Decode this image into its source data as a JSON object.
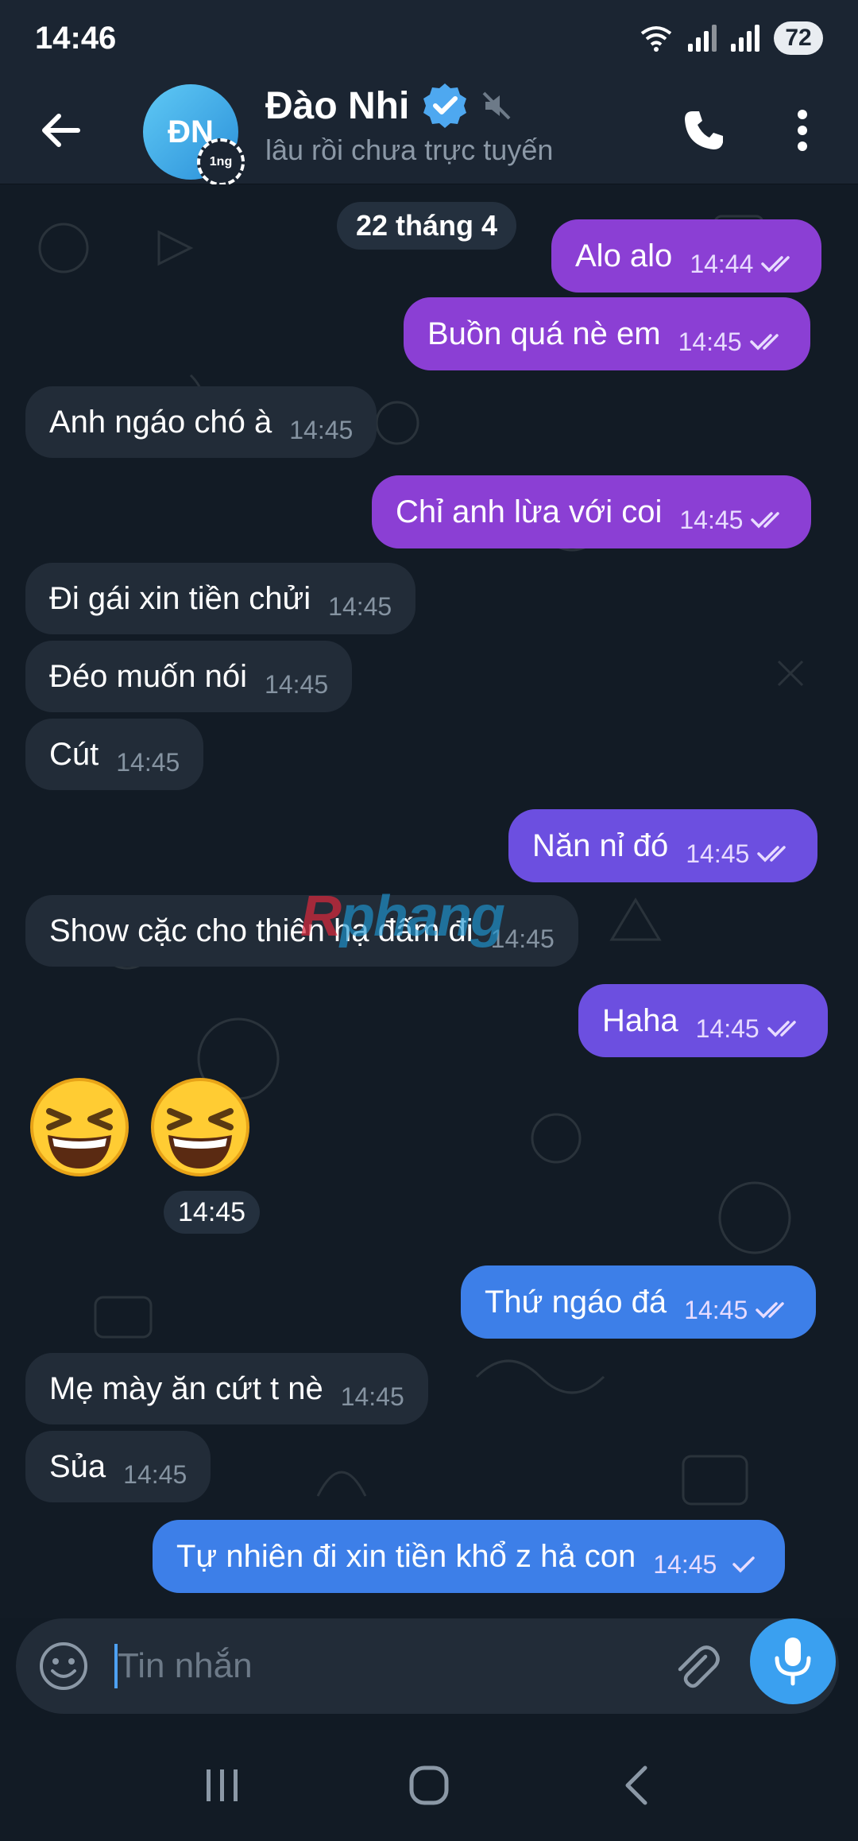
{
  "status_bar": {
    "time": "14:46",
    "battery": "72",
    "network": "5"
  },
  "header": {
    "contact_name": "Đào Nhi",
    "avatar_initials": "ĐN",
    "story_badge": "1ng",
    "last_seen": "lâu rồi chưa trực tuyến",
    "verified": true,
    "muted": true
  },
  "chat": {
    "date_separator": "22 tháng 4",
    "messages": [
      {
        "direction": "out",
        "text": "Alo alo",
        "time": "14:44",
        "status": "read"
      },
      {
        "direction": "out",
        "text": "Buồn quá nè em",
        "time": "14:45",
        "status": "read"
      },
      {
        "direction": "in",
        "text": "Anh ngáo chó à",
        "time": "14:45"
      },
      {
        "direction": "out",
        "text": "Chỉ anh lừa với coi",
        "time": "14:45",
        "status": "read"
      },
      {
        "direction": "in",
        "text": "Đi gái xin tiền chửi",
        "time": "14:45"
      },
      {
        "direction": "in",
        "text": "Đéo muốn nói",
        "time": "14:45"
      },
      {
        "direction": "in",
        "text": "Cút",
        "time": "14:45"
      },
      {
        "direction": "out",
        "text": "Năn nỉ đó",
        "time": "14:45",
        "status": "read"
      },
      {
        "direction": "in",
        "text": "Show cặc cho thiên hạ đấm đi",
        "time": "14:45"
      },
      {
        "direction": "out",
        "text": "Haha",
        "time": "14:45",
        "status": "read"
      },
      {
        "direction": "in",
        "type": "emoji",
        "emoji": [
          "grinning-squinting-face",
          "grinning-squinting-face"
        ],
        "time": "14:45"
      },
      {
        "direction": "out",
        "text": "Thứ ngáo đá",
        "time": "14:45",
        "status": "read"
      },
      {
        "direction": "in",
        "text": "Mẹ mày ăn cứt t nè",
        "time": "14:45"
      },
      {
        "direction": "in",
        "text": "Sủa",
        "time": "14:45"
      },
      {
        "direction": "out",
        "text": "Tự nhiên đi xin tiền khổ z hả con",
        "time": "14:45",
        "status": "sent"
      }
    ],
    "watermark": {
      "prefix": "R",
      "rest": "phang"
    }
  },
  "composer": {
    "placeholder": "Tin nhắn",
    "value": ""
  },
  "colors": {
    "header_bg": "#1b2532",
    "chat_bg": "#121b25",
    "incoming_bubble": "#222c38",
    "outgoing_purple": "#8b3fd4",
    "outgoing_indigo": "#6c4fe0",
    "outgoing_blue": "#3d7fe8",
    "accent": "#3aa0f0"
  },
  "icons": {
    "back": "arrow-left-icon",
    "verified": "verified-badge-icon",
    "muted": "speaker-muted-icon",
    "call": "phone-icon",
    "more": "more-vertical-icon",
    "emoji": "smiley-icon",
    "attach": "paperclip-icon",
    "mic": "microphone-icon",
    "nav_recents": "recents-icon",
    "nav_home": "home-icon",
    "nav_back": "back-chevron-icon"
  }
}
